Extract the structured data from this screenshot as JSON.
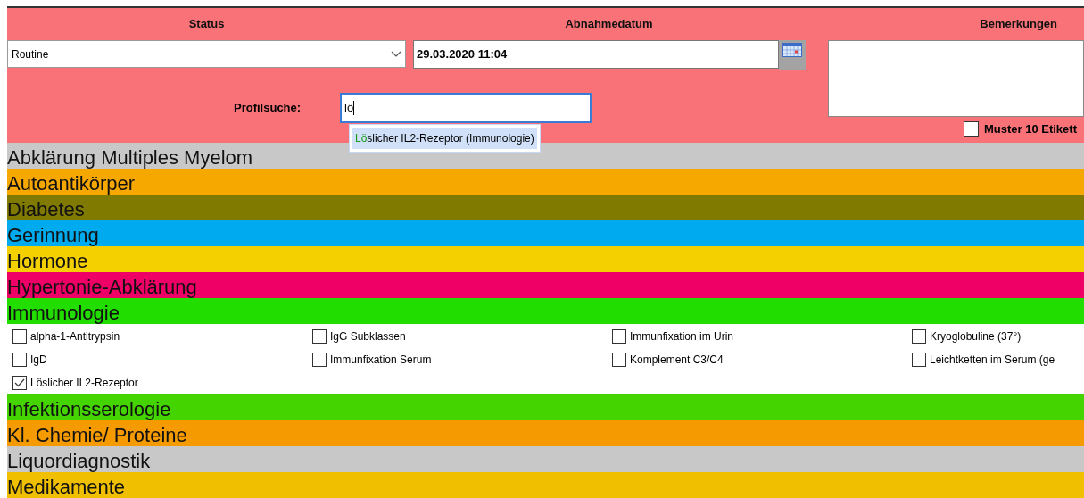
{
  "header": {
    "status_label": "Status",
    "date_label": "Abnahmedatum",
    "remarks_label": "Bemerkungen"
  },
  "status_select": {
    "value": "Routine"
  },
  "date_field": {
    "value": "29.03.2020 11:04"
  },
  "profile_search": {
    "label": "Profilsuche:",
    "value": "lö"
  },
  "suggestion": {
    "match": "Lö",
    "rest": "slicher IL2-Rezeptor (Immunologie)",
    "selected": true
  },
  "label_option": {
    "label": "Muster 10 Etikett",
    "checked": false
  },
  "categories": [
    {
      "name": "Abklärung Multiples Myelom",
      "color": "#c8c8c8"
    },
    {
      "name": "Autoantikörper",
      "color": "#f7a800"
    },
    {
      "name": "Diabetes",
      "color": "#807a00"
    },
    {
      "name": "Gerinnung",
      "color": "#00aaee"
    },
    {
      "name": "Hormone",
      "color": "#f5d000"
    },
    {
      "name": "Hypertonie-Abklärung",
      "color": "#ee0066"
    },
    {
      "name": "Immunologie",
      "color": "#22dd00",
      "items": [
        {
          "label": "alpha-1-Antitrypsin",
          "checked": false
        },
        {
          "label": "IgG Subklassen",
          "checked": false
        },
        {
          "label": "Immunfixation im Urin",
          "checked": false
        },
        {
          "label": "Kryoglobuline (37°)",
          "checked": false
        },
        {
          "label": "IgD",
          "checked": false
        },
        {
          "label": "Immunfixation Serum",
          "checked": false
        },
        {
          "label": "Komplement C3/C4",
          "checked": false
        },
        {
          "label": "Leichtketten im Serum (ge",
          "checked": false
        },
        {
          "label": "Löslicher IL2-Rezeptor",
          "checked": true
        }
      ]
    },
    {
      "name": "Infektionsserologie",
      "color": "#44d400"
    },
    {
      "name": "Kl. Chemie/ Proteine",
      "color": "#f59a00"
    },
    {
      "name": "Liquordiagnostik",
      "color": "#c8c8c8"
    },
    {
      "name": "Medikamente",
      "color": "#f0c000"
    }
  ]
}
